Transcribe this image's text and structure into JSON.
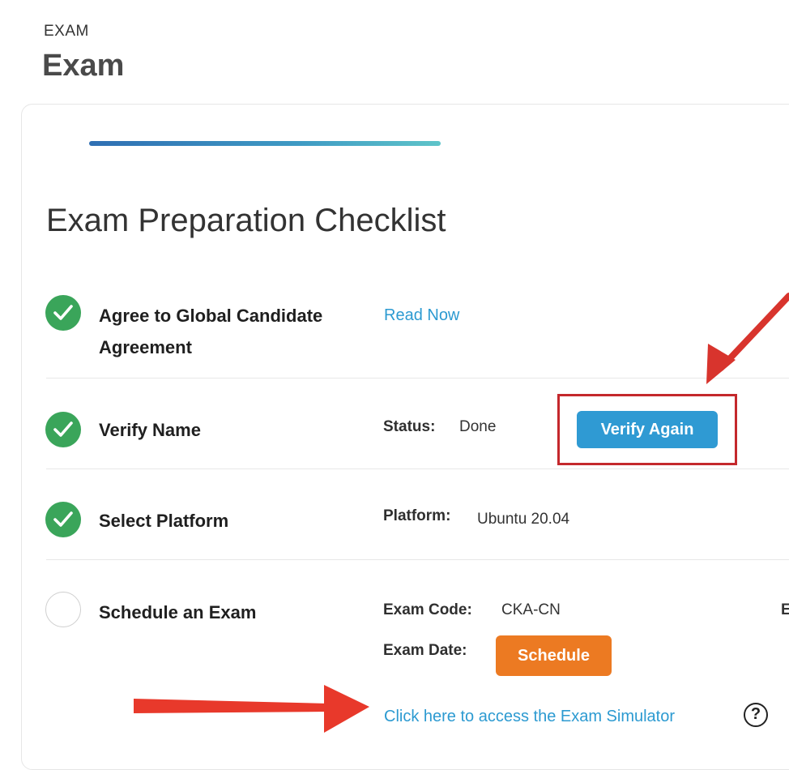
{
  "header": {
    "eyebrow": "EXAM",
    "title": "Exam"
  },
  "checklist": {
    "title": "Exam Preparation Checklist",
    "progress_fraction": 0.75,
    "items": [
      {
        "label_line1": "Agree to Global Candidate",
        "label_line2": "Agreement",
        "status": "done",
        "link": "Read Now"
      },
      {
        "label": "Verify Name",
        "status": "done",
        "status_key": "Status:",
        "status_value": "Done",
        "button": "Verify Again"
      },
      {
        "label": "Select Platform",
        "status": "done",
        "platform_key": "Platform:",
        "platform_value": "Ubuntu 20.04"
      },
      {
        "label": "Schedule an Exam",
        "status": "pending",
        "exam_code_key": "Exam Code:",
        "exam_code_value": "CKA-CN",
        "exam_date_key": "Exam Date:",
        "button": "Schedule",
        "simulator_link": "Click here to access the Exam Simulator",
        "help_glyph": "?",
        "cut_off_char": "E"
      }
    ]
  },
  "colors": {
    "done_green": "#3aa55a",
    "link_blue": "#2c9ad1",
    "verify_button": "#2f9ad3",
    "schedule_button": "#ec7a22",
    "annotation_red": "#c4282c",
    "arrow_red": "#e8392b"
  },
  "icons": {
    "check": "checkmark-icon",
    "help": "question-circle-icon"
  }
}
